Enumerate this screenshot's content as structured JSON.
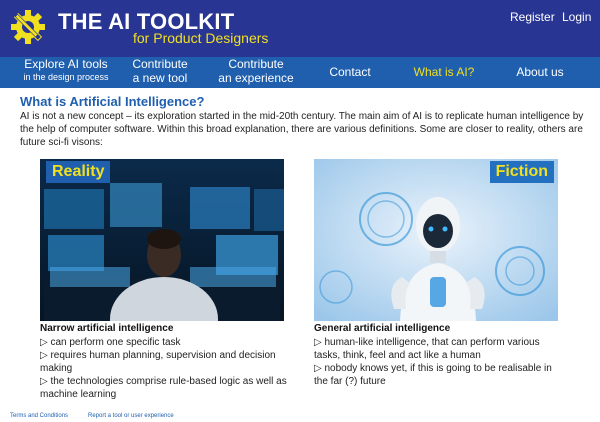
{
  "header": {
    "title": "THE AI TOOLKIT",
    "subtitle": "for Product Designers",
    "register": "Register",
    "login": "Login"
  },
  "nav": {
    "explore_l1": "Explore AI tools",
    "explore_l2": "in the design process",
    "contribute_tool_l1": "Contribute",
    "contribute_tool_l2": "a new tool",
    "contribute_exp_l1": "Contribute",
    "contribute_exp_l2": "an experience",
    "contact": "Contact",
    "what_is_ai": "What is AI?",
    "about": "About us"
  },
  "main": {
    "title": "What is Artificial Intelligence?",
    "intro": "AI is not a new concept – its exploration started in the mid-20th century. The main aim of AI is to replicate human intelligence by the help of computer software. Within this broad explanation, there are various definitions. Some are closer to reality, others are future sci-fi visons:"
  },
  "reality": {
    "label": "Reality",
    "title": "Narrow artificial intelligence",
    "items": [
      "▷ can perform one specific task",
      "▷ requires human planning, supervision and decision making",
      "▷ the technologies comprise rule-based logic as well as machine learning"
    ]
  },
  "fiction": {
    "label": "Fiction",
    "title": "General artificial intelligence",
    "items": [
      "▷ human-like intelligence, that can perform various tasks, think, feel and act like a human",
      "▷ nobody knows yet, if this is going to be realisable in the far (?) future"
    ]
  },
  "footer": {
    "terms": "Terms and Conditions",
    "report": "Report a tool or user experience"
  },
  "colors": {
    "header_bg": "#283593",
    "nav_bg": "#1f5fae",
    "accent_yellow": "#f0e020",
    "title_blue": "#1f5fae"
  },
  "icons": {
    "logo": "gear-pencil-icon"
  }
}
